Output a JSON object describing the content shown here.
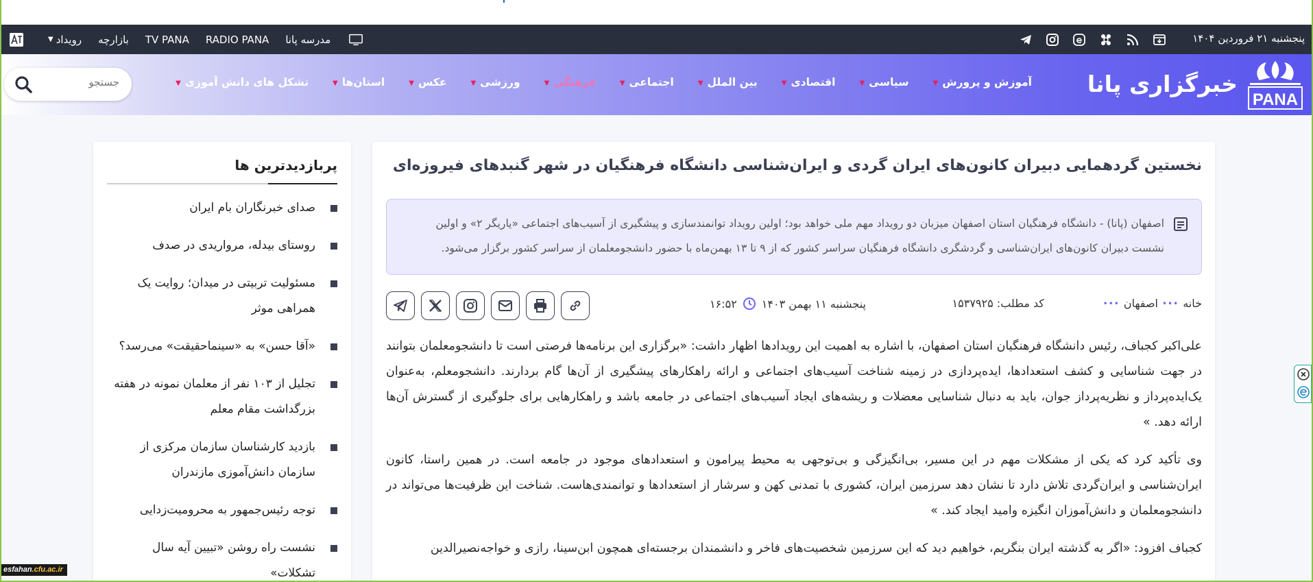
{
  "topbar": {
    "date": "پنجشنبه ۲۱ فروردین ۱۴۰۴",
    "social_icons": [
      "archive-icon",
      "rss-icon",
      "aparat-icon",
      "eitaa-icon",
      "instagram-icon",
      "telegram-icon"
    ],
    "menu": [
      {
        "label": "رویداد",
        "has_dropdown": true
      },
      {
        "label": "بازارچه"
      },
      {
        "label": "TV PANA"
      },
      {
        "label": "RADIO PANA"
      },
      {
        "label": "مدرسه پانا"
      }
    ]
  },
  "navbar": {
    "brand": "خبرگزاری پانا",
    "brand_latin": "PANA",
    "menu": [
      {
        "label": "آموزش و پرورش",
        "active": false
      },
      {
        "label": "سیاسی",
        "active": false
      },
      {
        "label": "اقتصادی",
        "active": false
      },
      {
        "label": "بین الملل",
        "active": false
      },
      {
        "label": "اجتماعی",
        "active": false
      },
      {
        "label": "فرهنگی",
        "active": true
      },
      {
        "label": "ورزشی",
        "active": false
      },
      {
        "label": "عکس",
        "active": false
      },
      {
        "label": "استان‌ها",
        "active": false
      },
      {
        "label": "تشکل های دانش آموزی",
        "active": false
      }
    ],
    "search_placeholder": "جستجو"
  },
  "article": {
    "title": "نخستین گردهمایی دبیران کانون‌های ایران گردی و ایران‌شناسی دانشگاه فرهنگیان در شهر گنبدهای فیروزه‌ای",
    "lead_line1": "اصفهان (پانا) - دانشگاه فرهنگیان استان اصفهان میزبان دو رویداد مهم ملی خواهد بود؛ اولین رویداد توانمندسازی و پیشگیری از آسیب‌های اجتماعی «یاریگر ۲» و اولین",
    "lead_line2": "نشست دبیران کانون‌های ایران‌شناسی و گردشگری دانشگاه فرهنگیان سراسر کشور که از ۹ تا ۱۳ بهمن‌ماه با حضور دانشجومعلمان از سراسر کشور برگزار می‌شود.",
    "breadcrumb_home": "خانه",
    "breadcrumb_province": "اصفهان",
    "code_label": "کد مطلب:",
    "code_value": "۱۵۳۷۹۲۵",
    "publish_date": "پنجشنبه ۱۱ بهمن ۱۴۰۳",
    "publish_time": "۱۶:۵۲",
    "paragraphs": [
      "علی‌اکبر کجباف، رئیس دانشگاه فرهنگیان استان اصفهان، با اشاره به اهمیت این رویدادها اظهار داشت: «برگزاری این برنامه‌ها فرصتی است تا دانشجومعلمان بتوانند در جهت شناسایی و کشف استعدادها، ایده‌پردازی در زمینه شناخت آسیب‌های اجتماعی و ارائه راهکارهای پیشگیری از آن‌ها گام بردارند. دانشجومعلم، به‌عنوان یک‌ایده‌پرداز و نظریه‌پرداز جوان، باید به دنبال شناسایی معضلات و ریشه‌های ایجاد آسیب‌های اجتماعی در جامعه باشد و راهکارهایی برای جلوگیری از گسترش آن‌ها ارائه دهد. »",
      "وی تأکید کرد که یکی از مشکلات مهم در این مسیر، بی‌انگیزگی و بی‌توجهی به محیط پیرامون و استعدادهای موجود در جامعه است. در همین راستا، کانون ایران‌شناسی و ایران‌گردی تلاش دارد تا نشان دهد سرزمین ایران، کشوری با تمدنی کهن و سرشار از استعدادها و توانمندی‌هاست. شناخت این ظرفیت‌ها می‌تواند در دانشجومعلمان و دانش‌آموزان انگیزه وامید ایجاد کند. »",
      "کجباف افزود: «اگر به گذشته ایران بنگریم، خواهیم دید که این سرزمین شخصیت‌های فاخر و دانشمندان برجسته‌ای همچون ابن‌سینا، رازی و خواجه‌نصیرالدین"
    ]
  },
  "sidebar": {
    "title": "پربازدیدترین ها",
    "items": [
      "صدای خبرنگاران بام ایران",
      "روستای بیدله، مرواریدی در صدف",
      "مسئولیت تربیتی در میدان؛ روایت یک همراهی موثر",
      "«آقا حسن» به «سینماحقیقت» می‌رسد؟",
      "تجلیل از ۱۰۳ نفر از معلمان نمونه در هفته بزرگداشت مقام معلم",
      "بازدید کارشناسان سازمان مرکزی از سازمان دانش‌آموزی مازندران",
      "توجه رئیس‌جمهور به محرومیت‌زدایی",
      "نشست راه روشن «تبیین آیه سال تشکلات»"
    ]
  },
  "badge": {
    "text_prefix": "esfahan",
    "text_suffix": ".cfu.ac.ir"
  },
  "colors": {
    "topbar": "#2a2f3d",
    "nav_gradient_end": "#5a56ee",
    "accent_pink": "#f472b6",
    "chevron": "#e91e63",
    "lead_bg": "#ecebfd"
  }
}
